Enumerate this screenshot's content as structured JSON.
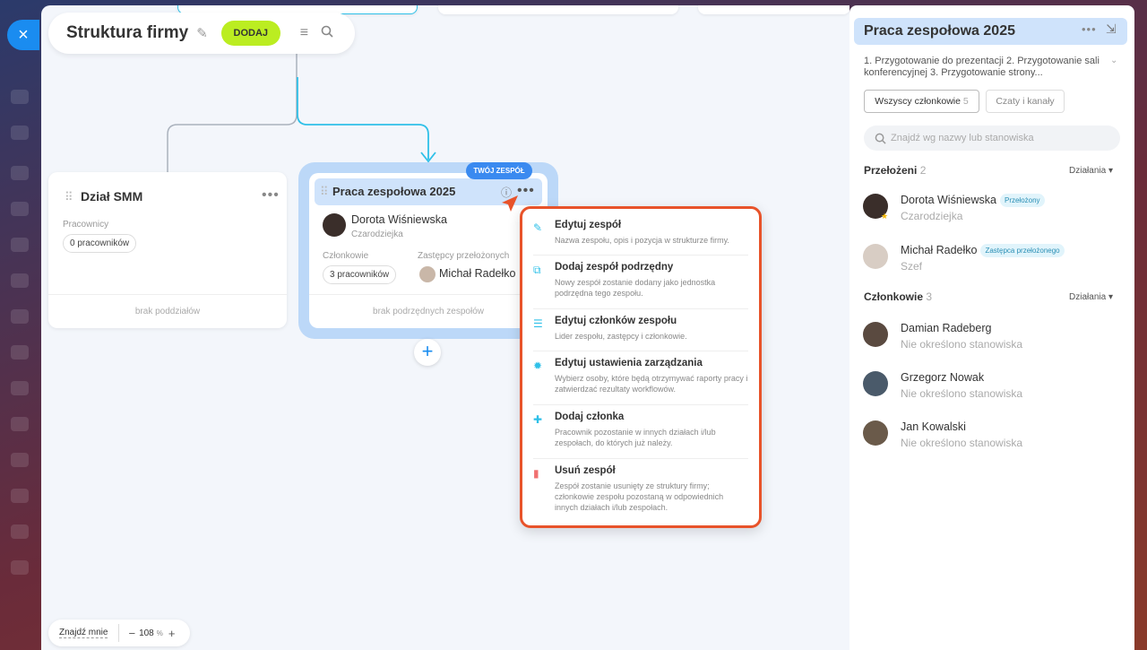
{
  "close": "×",
  "header": {
    "title": "Struktura firmy",
    "add_label": "DODAJ",
    "pin_icon": "pin-icon",
    "menu_icon": "menu-icon",
    "search_icon": "search-icon"
  },
  "dept_card": {
    "title": "Dział SMM",
    "employees_label": "Pracownicy",
    "employees_chip": "0 pracowników",
    "footer": "brak poddziałów"
  },
  "team_card": {
    "badge": "TWÓJ ZESPÓŁ",
    "title": "Praca zespołowa 2025",
    "head_name": "Dorota Wiśniewska",
    "head_role": "Czarodziejka",
    "members_label": "Członkowie",
    "members_chip": "3 pracowników",
    "deputy_label": "Zastępcy przełożonych",
    "deputy_name": "Michał Radełko",
    "footer": "brak podrzędnych zespołów",
    "add_symbol": "+"
  },
  "context_menu": {
    "items": [
      {
        "icon": "edit-icon",
        "title": "Edytuj zespół",
        "desc": "Nazwa zespołu, opis i pozycja w strukturze firmy."
      },
      {
        "icon": "add-subteam-icon",
        "title": "Dodaj zespół podrzędny",
        "desc": "Nowy zespół zostanie dodany jako jednostka podrzędna tego zespołu."
      },
      {
        "icon": "edit-members-icon",
        "title": "Edytuj członków zespołu",
        "desc": "Lider zespołu, zastępcy i członkowie."
      },
      {
        "icon": "gear-icon",
        "title": "Edytuj ustawienia zarządzania",
        "desc": "Wybierz osoby, które będą otrzymywać raporty pracy i zatwierdzać rezultaty workflowów."
      },
      {
        "icon": "add-member-icon",
        "title": "Dodaj członka",
        "desc": "Pracownik pozostanie w innych działach i/lub zespołach, do których już należy."
      },
      {
        "icon": "trash-icon",
        "title": "Usuń zespół",
        "desc": "Zespół zostanie usunięty ze struktury firmy; członkowie zespołu pozostaną w odpowiednich innych działach i/lub zespołach."
      }
    ]
  },
  "zoom": {
    "find_me": "Znajdź mnie",
    "minus": "−",
    "value": "108",
    "unit": "%",
    "plus": "+"
  },
  "panel": {
    "title": "Praca zespołowa 2025",
    "description": "1. Przygotowanie do prezentacji 2. Przygotowanie sali konferencyjnej 3. Przygotowanie strony...",
    "tab_all": "Wszyscy członkowie",
    "tab_all_count": "5",
    "tab_chats": "Czaty i kanały",
    "search_placeholder": "Znajdź wg nazwy lub stanowiska",
    "supervisors_title": "Przełożeni",
    "supervisors_count": "2",
    "actions_label": "Działania",
    "supervisors": [
      {
        "name": "Dorota Wiśniewska",
        "tag": "Przełożony",
        "role": "Czarodziejka"
      },
      {
        "name": "Michał Radełko",
        "tag": "Zastępca przełożonego",
        "role": "Szef"
      }
    ],
    "members_title": "Członkowie",
    "members_count": "3",
    "members": [
      {
        "name": "Damian Radeberg",
        "role": "Nie określono stanowiska"
      },
      {
        "name": "Grzegorz Nowak",
        "role": "Nie określono stanowiska"
      },
      {
        "name": "Jan Kowalski",
        "role": "Nie określono stanowiska"
      }
    ]
  }
}
